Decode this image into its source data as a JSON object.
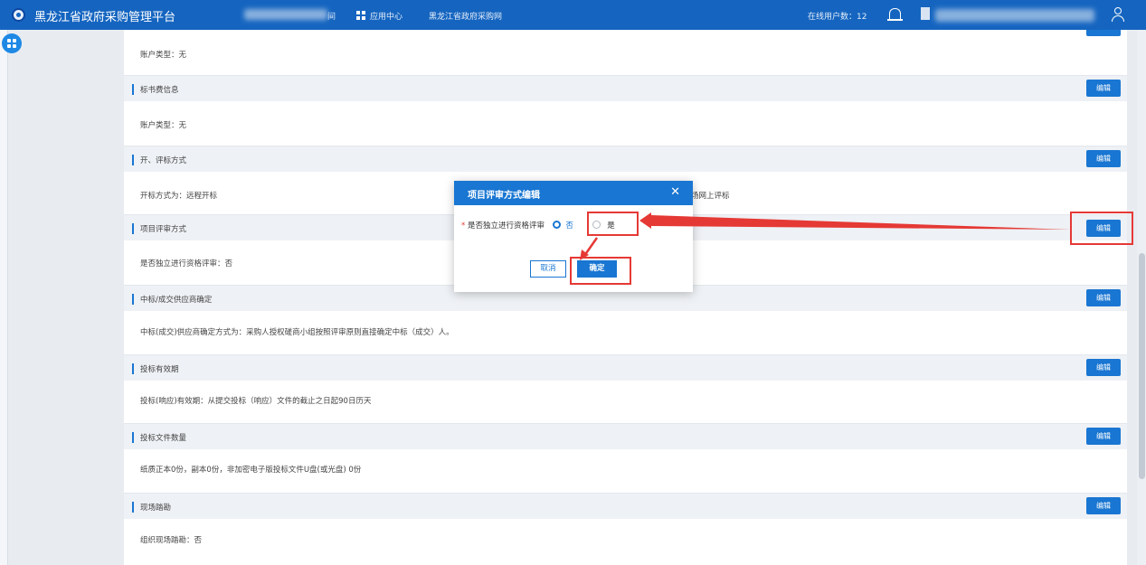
{
  "topbar": {
    "title": "黑龙江省政府采购管理平台",
    "nav_fragment": "间",
    "app_center": "应用中心",
    "site_link": "黑龙江省政府采购网",
    "online_users": "在线用户数：12"
  },
  "sections": [
    {
      "title": "",
      "body": "账户类型：无",
      "edit": ""
    },
    {
      "title": "标书费信息",
      "body": "账户类型：无",
      "edit": "编辑"
    },
    {
      "title": "开、评标方式",
      "body": "开标方式为：远程开标",
      "body_right": "场网上评标",
      "edit": "编辑"
    },
    {
      "title": "项目评审方式",
      "body": "是否独立进行资格评审：否",
      "edit": "编辑"
    },
    {
      "title": "中标/成交供应商确定",
      "body": "中标(成交)供应商确定方式为：采购人授权磋商小组按照评审原则直接确定中标（成交）人。",
      "edit": "编辑"
    },
    {
      "title": "投标有效期",
      "body": "投标(响应)有效期：从提交投标（响应）文件的截止之日起90日历天",
      "edit": "编辑"
    },
    {
      "title": "投标文件数量",
      "body": "纸质正本0份，副本0份，非加密电子版投标文件U盘(或光盘) 0份",
      "edit": "编辑"
    },
    {
      "title": "现场踏勘",
      "body": "组织现场踏勘：否",
      "edit": "编辑"
    }
  ],
  "modal": {
    "title": "项目评审方式编辑",
    "close": "✕",
    "required_mark": "*",
    "field_label": "是否独立进行资格评审",
    "option_no": "否",
    "option_yes": "是",
    "selected": "否",
    "cancel": "取消",
    "confirm": "确定"
  },
  "colors": {
    "primary": "#1976d2",
    "topbar": "#1565c0",
    "annotation": "#e53935"
  }
}
